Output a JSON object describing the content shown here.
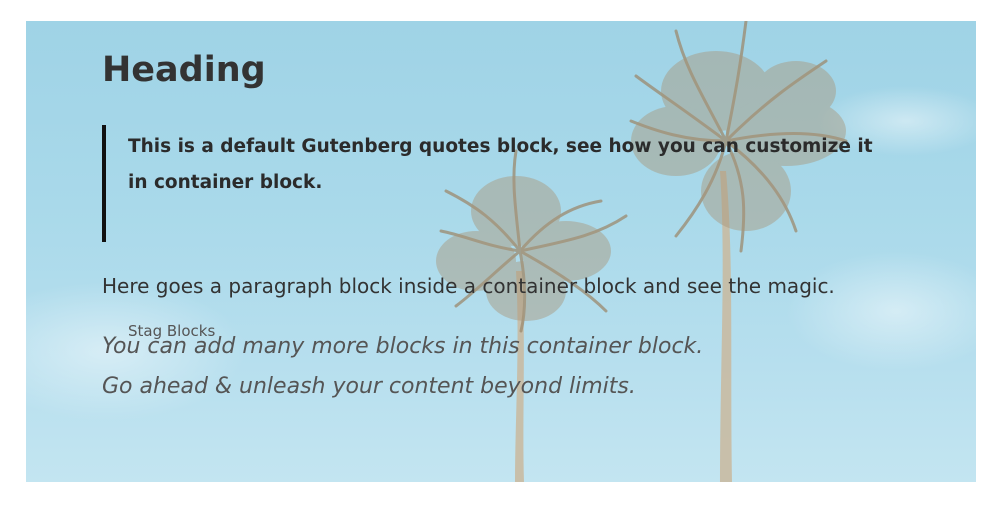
{
  "container": {
    "heading": "Heading",
    "quote": {
      "text": "This is a default Gutenberg quotes block, see how you can customize it in container block.",
      "citation": "Stag Blocks"
    },
    "paragraph": "Here goes a paragraph block inside a container block and see the magic.",
    "italic_lines": [
      "You can add many more blocks in this container block.",
      "Go ahead & unleash your content beyond limits."
    ]
  },
  "colors": {
    "sky_top": "#9fd3e6",
    "sky_bottom": "#c3e5f1",
    "heading_text": "#333333",
    "quote_border": "#111111",
    "italic_text": "#555555"
  }
}
